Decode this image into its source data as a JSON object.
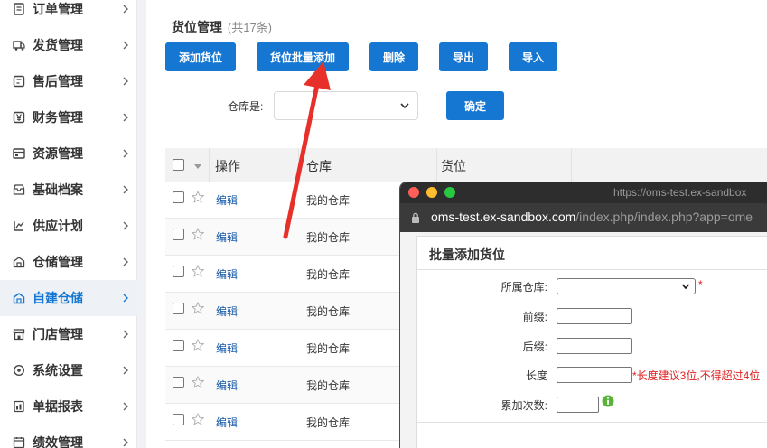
{
  "sidebar": {
    "items": [
      {
        "label": "订单管理",
        "icon": "order-doc-icon"
      },
      {
        "label": "发货管理",
        "icon": "shipping-icon"
      },
      {
        "label": "售后管理",
        "icon": "after-sales-icon"
      },
      {
        "label": "财务管理",
        "icon": "finance-yen-icon"
      },
      {
        "label": "资源管理",
        "icon": "resource-icon"
      },
      {
        "label": "基础档案",
        "icon": "archive-icon"
      },
      {
        "label": "供应计划",
        "icon": "supply-plan-icon"
      },
      {
        "label": "仓储管理",
        "icon": "warehouse-icon"
      },
      {
        "label": "自建仓储",
        "icon": "self-warehouse-icon",
        "active": true
      },
      {
        "label": "门店管理",
        "icon": "store-icon"
      },
      {
        "label": "系统设置",
        "icon": "settings-icon"
      },
      {
        "label": "单据报表",
        "icon": "report-icon"
      },
      {
        "label": "绩效管理",
        "icon": "performance-icon"
      }
    ]
  },
  "header": {
    "title": "货位管理",
    "count": "(共17条)"
  },
  "toolbar": {
    "add_label": "添加货位",
    "batch_add_label": "货位批量添加",
    "delete_label": "删除",
    "export_label": "导出",
    "import_label": "导入"
  },
  "filter": {
    "warehouse_label": "仓库是:",
    "warehouse_value": "",
    "confirm_label": "确定"
  },
  "table": {
    "headers": [
      "操作",
      "仓库",
      "货位"
    ],
    "rows": [
      {
        "action": "编辑",
        "warehouse": "我的仓库"
      },
      {
        "action": "编辑",
        "warehouse": "我的仓库"
      },
      {
        "action": "编辑",
        "warehouse": "我的仓库"
      },
      {
        "action": "编辑",
        "warehouse": "我的仓库"
      },
      {
        "action": "编辑",
        "warehouse": "我的仓库"
      },
      {
        "action": "编辑",
        "warehouse": "我的仓库"
      },
      {
        "action": "编辑",
        "warehouse": "我的仓库"
      }
    ]
  },
  "popup": {
    "window_title": "https://oms-test.ex-sandbox",
    "url_host": "oms-test.ex-sandbox.com",
    "url_path": "/index.php/index.php?app=ome",
    "form_title": "批量添加货位",
    "fields": {
      "warehouse_label": "所属仓库:",
      "warehouse_required": "*",
      "prefix_label": "前缀:",
      "suffix_label": "后缀:",
      "length_label": "长度",
      "length_hint": "*长度建议3位,不得超过4位",
      "count_label": "累加次数:"
    }
  },
  "colors": {
    "accent": "#1677d2",
    "arrow": "#e8302a",
    "required": "#e02020",
    "info": "#5bb33a"
  }
}
